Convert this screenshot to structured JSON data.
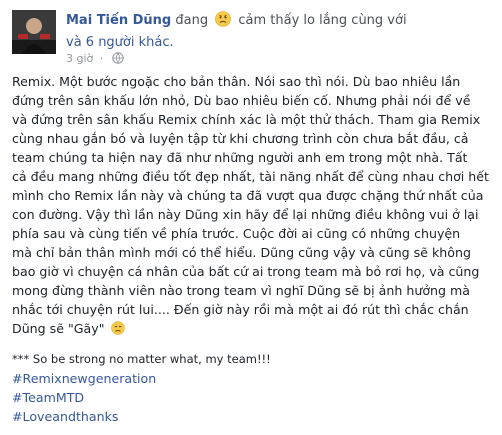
{
  "post": {
    "author": "Mai Tiến Dũng",
    "status_prefix": "đang",
    "feeling_text": "cảm thấy lo lắng cùng với",
    "others_link": "và 6 người khác.",
    "time": "3 giờ",
    "body_lines": [
      "Remix. Một bước ngoặc cho bản thân. Nói sao thì nói. Dù bao nhiêu lần",
      "đứng trên sân khấu lớn nhỏ, Dù bao nhiêu biến cố. Nhưng phải nói để về",
      "và đứng trên sân khấu Remix chính xác là một thử thách. Tham gia Remix",
      "cùng nhau gắn bó và luyện tập từ khi chương trình còn chưa bắt đầu, cả",
      "team chúng ta hiện nay đã như những người anh em trong một nhà. Tất",
      "cả đều mang những điều tốt đẹp nhất, tài năng nhất để cùng nhau chơi hết",
      "mình cho Remix lần này và chúng ta đã vượt qua được chặng thứ nhất của",
      "con đường. Vậy thì lần này Dũng xin hãy để lại những điều không vui ở lại",
      "phía sau và cùng tiến về phía trước. Cuộc đời ai cũng có những chuyện",
      "mà chỉ bản thân mình mới có thể hiểu. Dũng cũng vậy và cũng sẽ không",
      "bao giờ vì chuyện cá nhân của bất cứ ai trong team mà bỏ rơi họ, và cũng",
      "mong đừng thành viên nào trong team vì nghĩ Dũng sẽ bị ảnh hưởng mà",
      "nhắc tới chuyện rút lui.... Đến giờ này rồi mà một ai đó rút thì chắc chắn"
    ],
    "last_line_text": "Dũng sẽ \"Gãy\"",
    "note": "*** So be strong no matter what, my team!!!",
    "hashtags": [
      "#Remixnewgeneration",
      "#TeamMTD",
      "#Loveandthanks"
    ]
  },
  "icons": {
    "avatar": "avatar-photo",
    "feeling": "worried-face-icon",
    "privacy": "globe-icon",
    "sad": "sad-face-icon"
  },
  "colors": {
    "link": "#365899",
    "text": "#1d2129",
    "meta": "#90949c"
  }
}
